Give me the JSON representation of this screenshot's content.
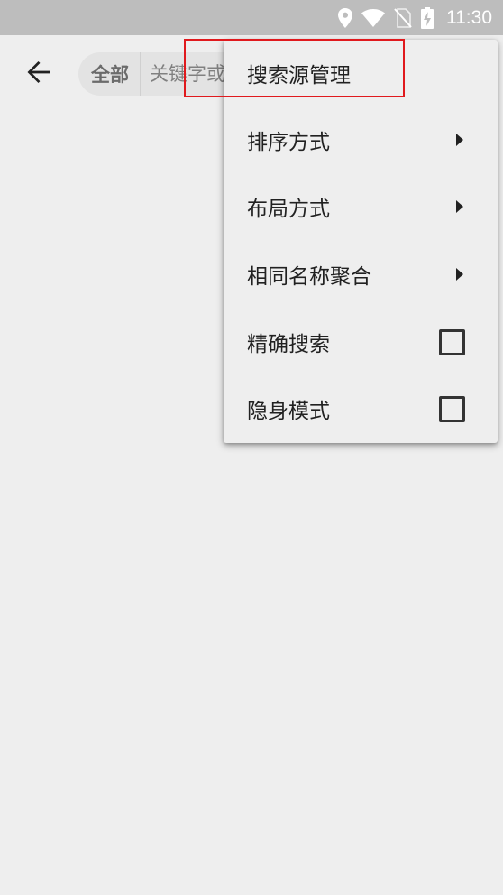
{
  "status_bar": {
    "time": "11:30",
    "icons": [
      "location-icon",
      "wifi-icon",
      "no-sim-icon",
      "battery-charging-icon"
    ]
  },
  "toolbar": {
    "back_icon": "arrow-left-icon",
    "scope_label": "全部",
    "search_placeholder": "关键字或作者",
    "search_value": ""
  },
  "menu": {
    "items": [
      {
        "label": "搜索源管理",
        "type": "action"
      },
      {
        "label": "排序方式",
        "type": "submenu"
      },
      {
        "label": "布局方式",
        "type": "submenu"
      },
      {
        "label": "相同名称聚合",
        "type": "submenu"
      },
      {
        "label": "精确搜索",
        "type": "checkbox",
        "checked": false
      },
      {
        "label": "隐身模式",
        "type": "checkbox",
        "checked": false
      }
    ]
  },
  "colors": {
    "status_bar": "#bdbdbd",
    "background": "#eeeeee",
    "highlight": "#e0191d"
  }
}
